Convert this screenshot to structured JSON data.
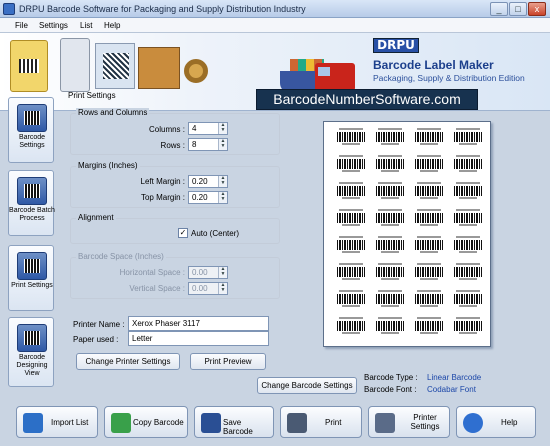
{
  "window": {
    "title": "DRPU Barcode Software for Packaging and Supply Distribution Industry",
    "minimize": "_",
    "maximize": "□",
    "close": "x"
  },
  "menu": [
    "File",
    "Settings",
    "List",
    "Help"
  ],
  "banner": {
    "logo": "DRPU",
    "title": "Barcode Label Maker",
    "subtitle": "Packaging, Supply & Distribution Edition",
    "url": "BarcodeNumberSoftware.com"
  },
  "sidebar": [
    {
      "label": "Barcode Settings"
    },
    {
      "label": "Barcode Batch Process"
    },
    {
      "label": "Print Settings"
    },
    {
      "label": "Barcode Designing View"
    }
  ],
  "print_settings": {
    "heading": "Print Settings",
    "rows_columns": {
      "heading": "Rows and Columns",
      "columns_label": "Columns :",
      "columns_value": "4",
      "rows_label": "Rows :",
      "rows_value": "8"
    },
    "margins": {
      "heading": "Margins (Inches)",
      "left_label": "Left Margin :",
      "left_value": "0.20",
      "top_label": "Top Margin :",
      "top_value": "0.20"
    },
    "alignment": {
      "heading": "Alignment",
      "auto_label": "Auto (Center)",
      "checked": true,
      "check_mark": "✓"
    },
    "barcode_space": {
      "heading": "Barcode Space (Inches)",
      "h_label": "Horizontal Space :",
      "h_value": "0.00",
      "v_label": "Vertical Space :",
      "v_value": "0.00"
    },
    "printer_name_label": "Printer Name :",
    "printer_name": "Xerox Phaser 3117",
    "paper_label": "Paper used :",
    "paper": "Letter",
    "change_printer_button": "Change Printer Settings",
    "print_preview_button": "Print Preview"
  },
  "preview": {
    "columns": 4,
    "rows": 8
  },
  "change_barcode_button": "Change Barcode Settings",
  "barcode_info": {
    "type_label": "Barcode Type :",
    "type_value": "Linear Barcode",
    "font_label": "Barcode Font :",
    "font_value": "Codabar Font"
  },
  "toolbar": [
    {
      "label": "Import List",
      "icon": "import-list-icon",
      "color": "#2c6fc7"
    },
    {
      "label": "Copy Barcode",
      "icon": "copy-barcode-icon",
      "color": "#39a04a"
    },
    {
      "label": "Save Barcode",
      "icon": "save-icon",
      "color": "#2a4f94"
    },
    {
      "label": "Print",
      "icon": "printer-icon",
      "color": "#4a5a73"
    },
    {
      "label": "Printer Settings",
      "icon": "printer-settings-icon",
      "color": "#5a6b88"
    },
    {
      "label": "Help",
      "icon": "help-icon",
      "color": "#2f6fd0"
    }
  ]
}
